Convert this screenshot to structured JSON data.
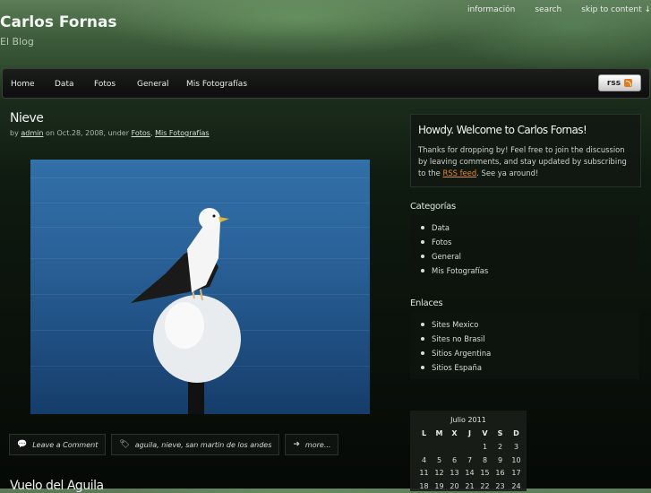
{
  "site": {
    "title": "Carlos Fornas",
    "tagline": "El Blog"
  },
  "topnav": [
    "información",
    "search",
    "skip to content ↓"
  ],
  "nav": [
    "Home",
    "Data",
    "Fotos",
    "General",
    "Mis Fotografías"
  ],
  "rss_label": "rss",
  "post": {
    "title": "Nieve",
    "meta_by": "by",
    "author": "admin",
    "meta_on": "on Oct.28, 2008, under",
    "cat1": "Fotos",
    "sep": ",",
    "cat2": "Mis Fotografías",
    "comment_label": "Leave a Comment",
    "tags": "aguila, nieve, san martin de los andes",
    "more_label": "more..."
  },
  "next_post_title": "Vuelo del Aguila",
  "welcome": {
    "title": "Howdy. Welcome to Carlos Fornas!",
    "text1": "Thanks for dropping by! Feel free to join the discussion by leaving comments, and stay updated by subscribing to the",
    "link": "RSS feed",
    "text2": ". See ya around!"
  },
  "categorias": {
    "title": "Categorías",
    "items": [
      "Data",
      "Fotos",
      "General",
      "Mis Fotografías"
    ]
  },
  "enlaces": {
    "title": "Enlaces",
    "items": [
      "Sites Mexico",
      "Sites no Brasil",
      "Sitios Argentina",
      "Sitios España"
    ]
  },
  "calendar": {
    "caption": "Julio 2011",
    "days": [
      "L",
      "M",
      "X",
      "J",
      "V",
      "S",
      "D"
    ],
    "rows": [
      [
        "",
        "",
        "",
        "",
        "1",
        "2",
        "3"
      ],
      [
        "4",
        "5",
        "6",
        "7",
        "8",
        "9",
        "10"
      ],
      [
        "11",
        "12",
        "13",
        "14",
        "15",
        "16",
        "17"
      ],
      [
        "18",
        "19",
        "20",
        "21",
        "22",
        "23",
        "24"
      ]
    ]
  },
  "colors": {
    "accent_link": "#e58a2a",
    "nav_bg": "#111311"
  }
}
